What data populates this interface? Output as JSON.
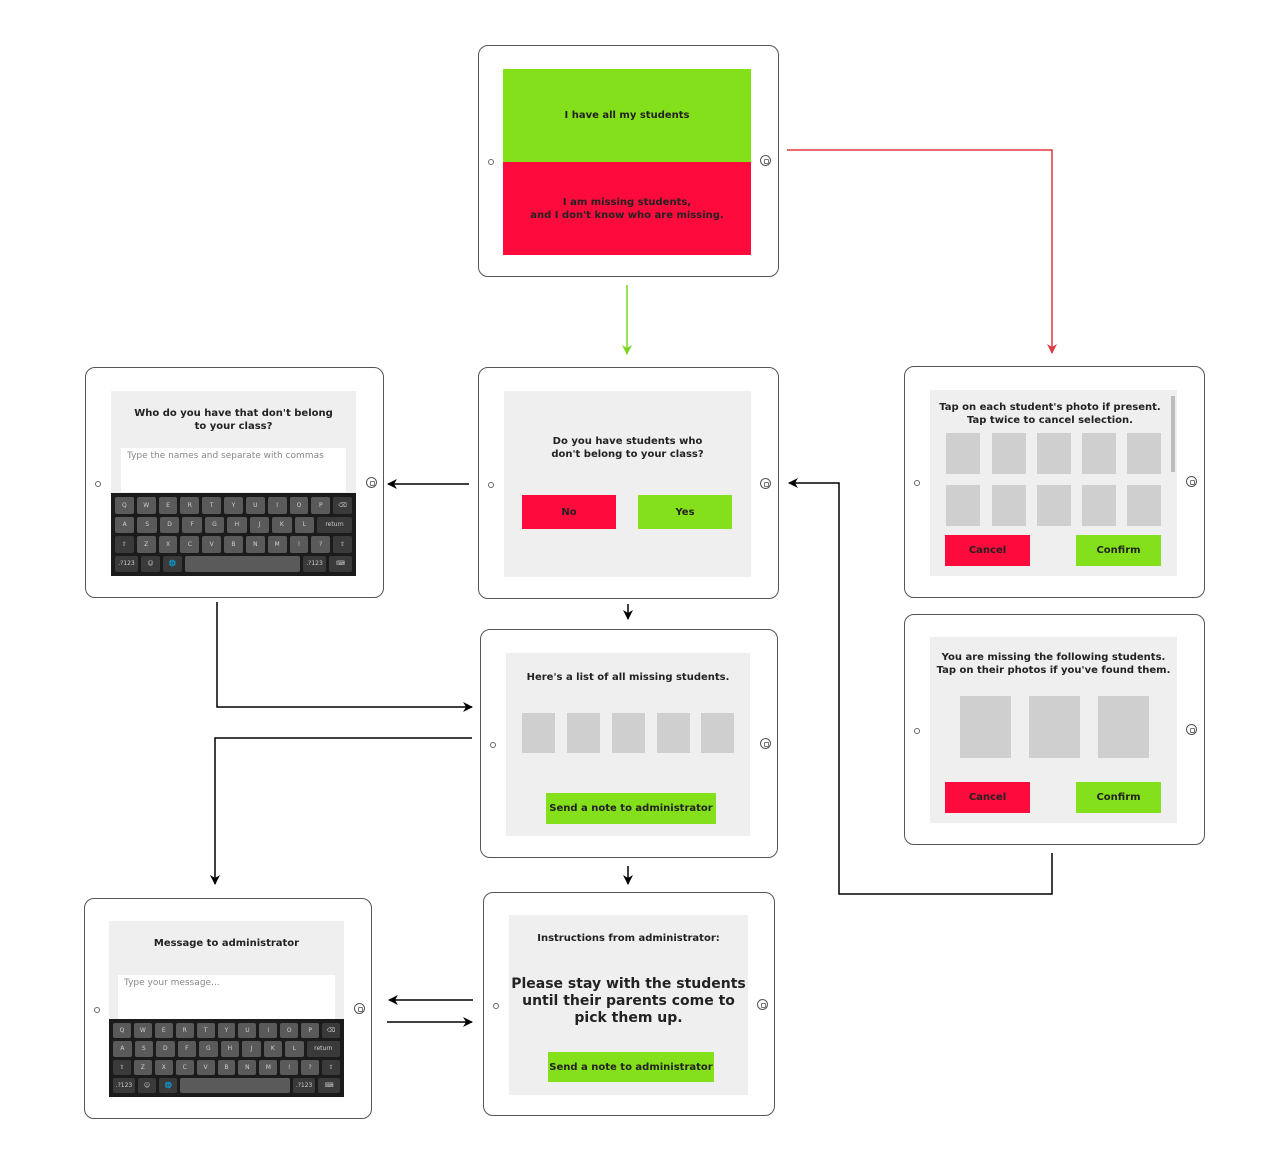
{
  "colors": {
    "green": "#84e01b",
    "red": "#ff0a3c",
    "screen_bg": "#efefef",
    "photo_placeholder": "#cfcfcf",
    "arrow_black": "#000000",
    "arrow_green": "#7ad420",
    "arrow_red": "#e0393e"
  },
  "screen_start": {
    "yes_option": "I have all my students",
    "no_option": "I am missing students,\nand I don't know who are missing."
  },
  "screen_question": {
    "question": "Do you have students who\ndon't belong to your class?",
    "no_button": "No",
    "yes_button": "Yes"
  },
  "screen_extra_students": {
    "question": "Who do you have that don't belong\nto your class?",
    "input_placeholder": "Type the names and separate with commas"
  },
  "screen_select_present": {
    "instruction": "Tap on each student's photo if present.\nTap twice to cancel selection.",
    "cancel_button": "Cancel",
    "confirm_button": "Confirm"
  },
  "screen_missing_list_right": {
    "instruction": "You are missing the following students.\nTap on their photos if you've found them.",
    "cancel_button": "Cancel",
    "confirm_button": "Confirm"
  },
  "screen_missing_list": {
    "heading": "Here's a list of all missing students.",
    "note_button": "Send a note to administrator"
  },
  "screen_message": {
    "heading": "Message to administrator",
    "input_placeholder": "Type your message..."
  },
  "screen_instructions": {
    "heading": "Instructions from administrator:",
    "message": "Please stay with the students\nuntil their parents come to\npick them up.",
    "note_button": "Send a note to administrator"
  },
  "keyboard": {
    "row1": [
      "Q",
      "W",
      "E",
      "R",
      "T",
      "Y",
      "U",
      "I",
      "O",
      "P",
      "⌫"
    ],
    "row2": [
      "A",
      "S",
      "D",
      "F",
      "G",
      "H",
      "J",
      "K",
      "L",
      "return"
    ],
    "row3": [
      "⇧",
      "Z",
      "X",
      "C",
      "V",
      "B",
      "N",
      "M",
      "!",
      "?",
      "⇧"
    ],
    "row4": [
      ".?123",
      "☺",
      "🌐",
      "",
      ".?123",
      "⌨"
    ]
  }
}
